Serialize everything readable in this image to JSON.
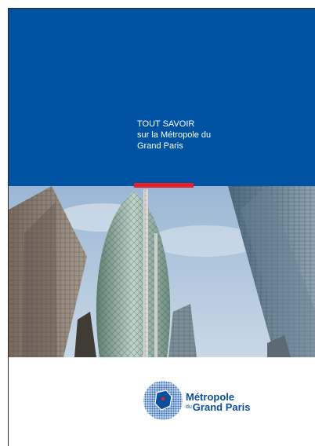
{
  "cover": {
    "title_line1": "TOUT SAVOIR",
    "title_line2": "sur la Métropole du",
    "title_line3": "Grand Paris"
  },
  "logo": {
    "line1": "Métropole",
    "du": "du",
    "line2": "Grand Paris"
  },
  "colors": {
    "brand_blue": "#0052a2",
    "accent_red": "#e5202e",
    "logo_blue": "#0b4f9c"
  },
  "photo": {
    "description_icon": "skyscrapers-photo"
  }
}
